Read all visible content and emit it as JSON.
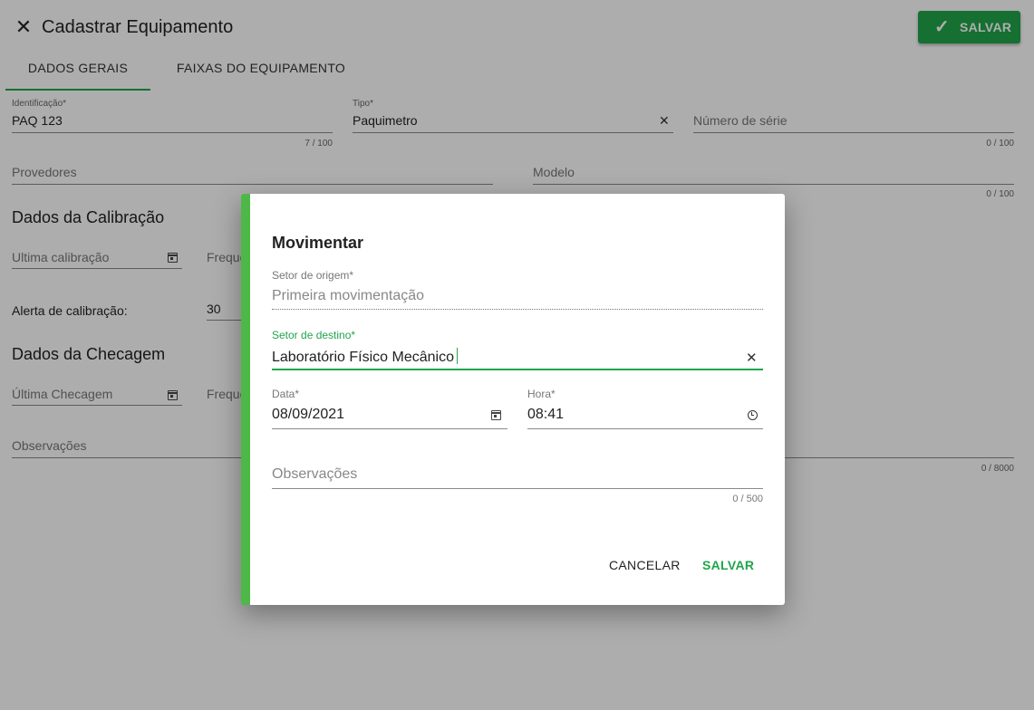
{
  "header": {
    "title": "Cadastrar Equipamento",
    "save_label": "SALVAR"
  },
  "tabs": [
    {
      "label": "DADOS GERAIS",
      "active": true
    },
    {
      "label": "FAIXAS DO EQUIPAMENTO",
      "active": false
    }
  ],
  "form": {
    "identificacao": {
      "label": "Identificação*",
      "value": "PAQ 123",
      "counter": "7 / 100"
    },
    "tipo": {
      "label": "Tipo*",
      "value": "Paquimetro"
    },
    "numero_serie": {
      "placeholder": "Número de série",
      "counter": "0 / 100"
    },
    "provedores": {
      "placeholder": "Provedores"
    },
    "modelo": {
      "placeholder": "Modelo",
      "counter": "0 / 100"
    },
    "section_calibracao": "Dados da Calibração",
    "ultima_calibracao": {
      "placeholder": "Ultima calibração"
    },
    "frequencia_calibracao": {
      "placeholder": "Freque"
    },
    "alerta_calibracao": {
      "label": "Alerta de calibração:",
      "value": "30"
    },
    "section_checagem": "Dados da Checagem",
    "ultima_checagem": {
      "placeholder": "Última Checagem"
    },
    "frequencia_checagem": {
      "placeholder": "Freque"
    },
    "observacoes": {
      "placeholder": "Observações",
      "counter": "0 / 8000"
    }
  },
  "dialog": {
    "title": "Movimentar",
    "setor_origem": {
      "label": "Setor de origem*",
      "placeholder": "Primeira movimentação"
    },
    "setor_destino": {
      "label": "Setor de destino*",
      "value": "Laboratório Físico Mecânico"
    },
    "data": {
      "label": "Data*",
      "value": "08/09/2021"
    },
    "hora": {
      "label": "Hora*",
      "value": "08:41"
    },
    "observacoes": {
      "placeholder": "Observações",
      "counter": "0 / 500"
    },
    "cancel_label": "CANCELAR",
    "save_label": "SALVAR"
  },
  "colors": {
    "accent": "#1fa64a",
    "dialog_stripe": "#4db848",
    "overlay": "rgba(0,0,0,0.32)"
  },
  "icons": [
    "close-icon",
    "check-icon",
    "calendar-icon",
    "clock-icon",
    "clear-icon"
  ]
}
